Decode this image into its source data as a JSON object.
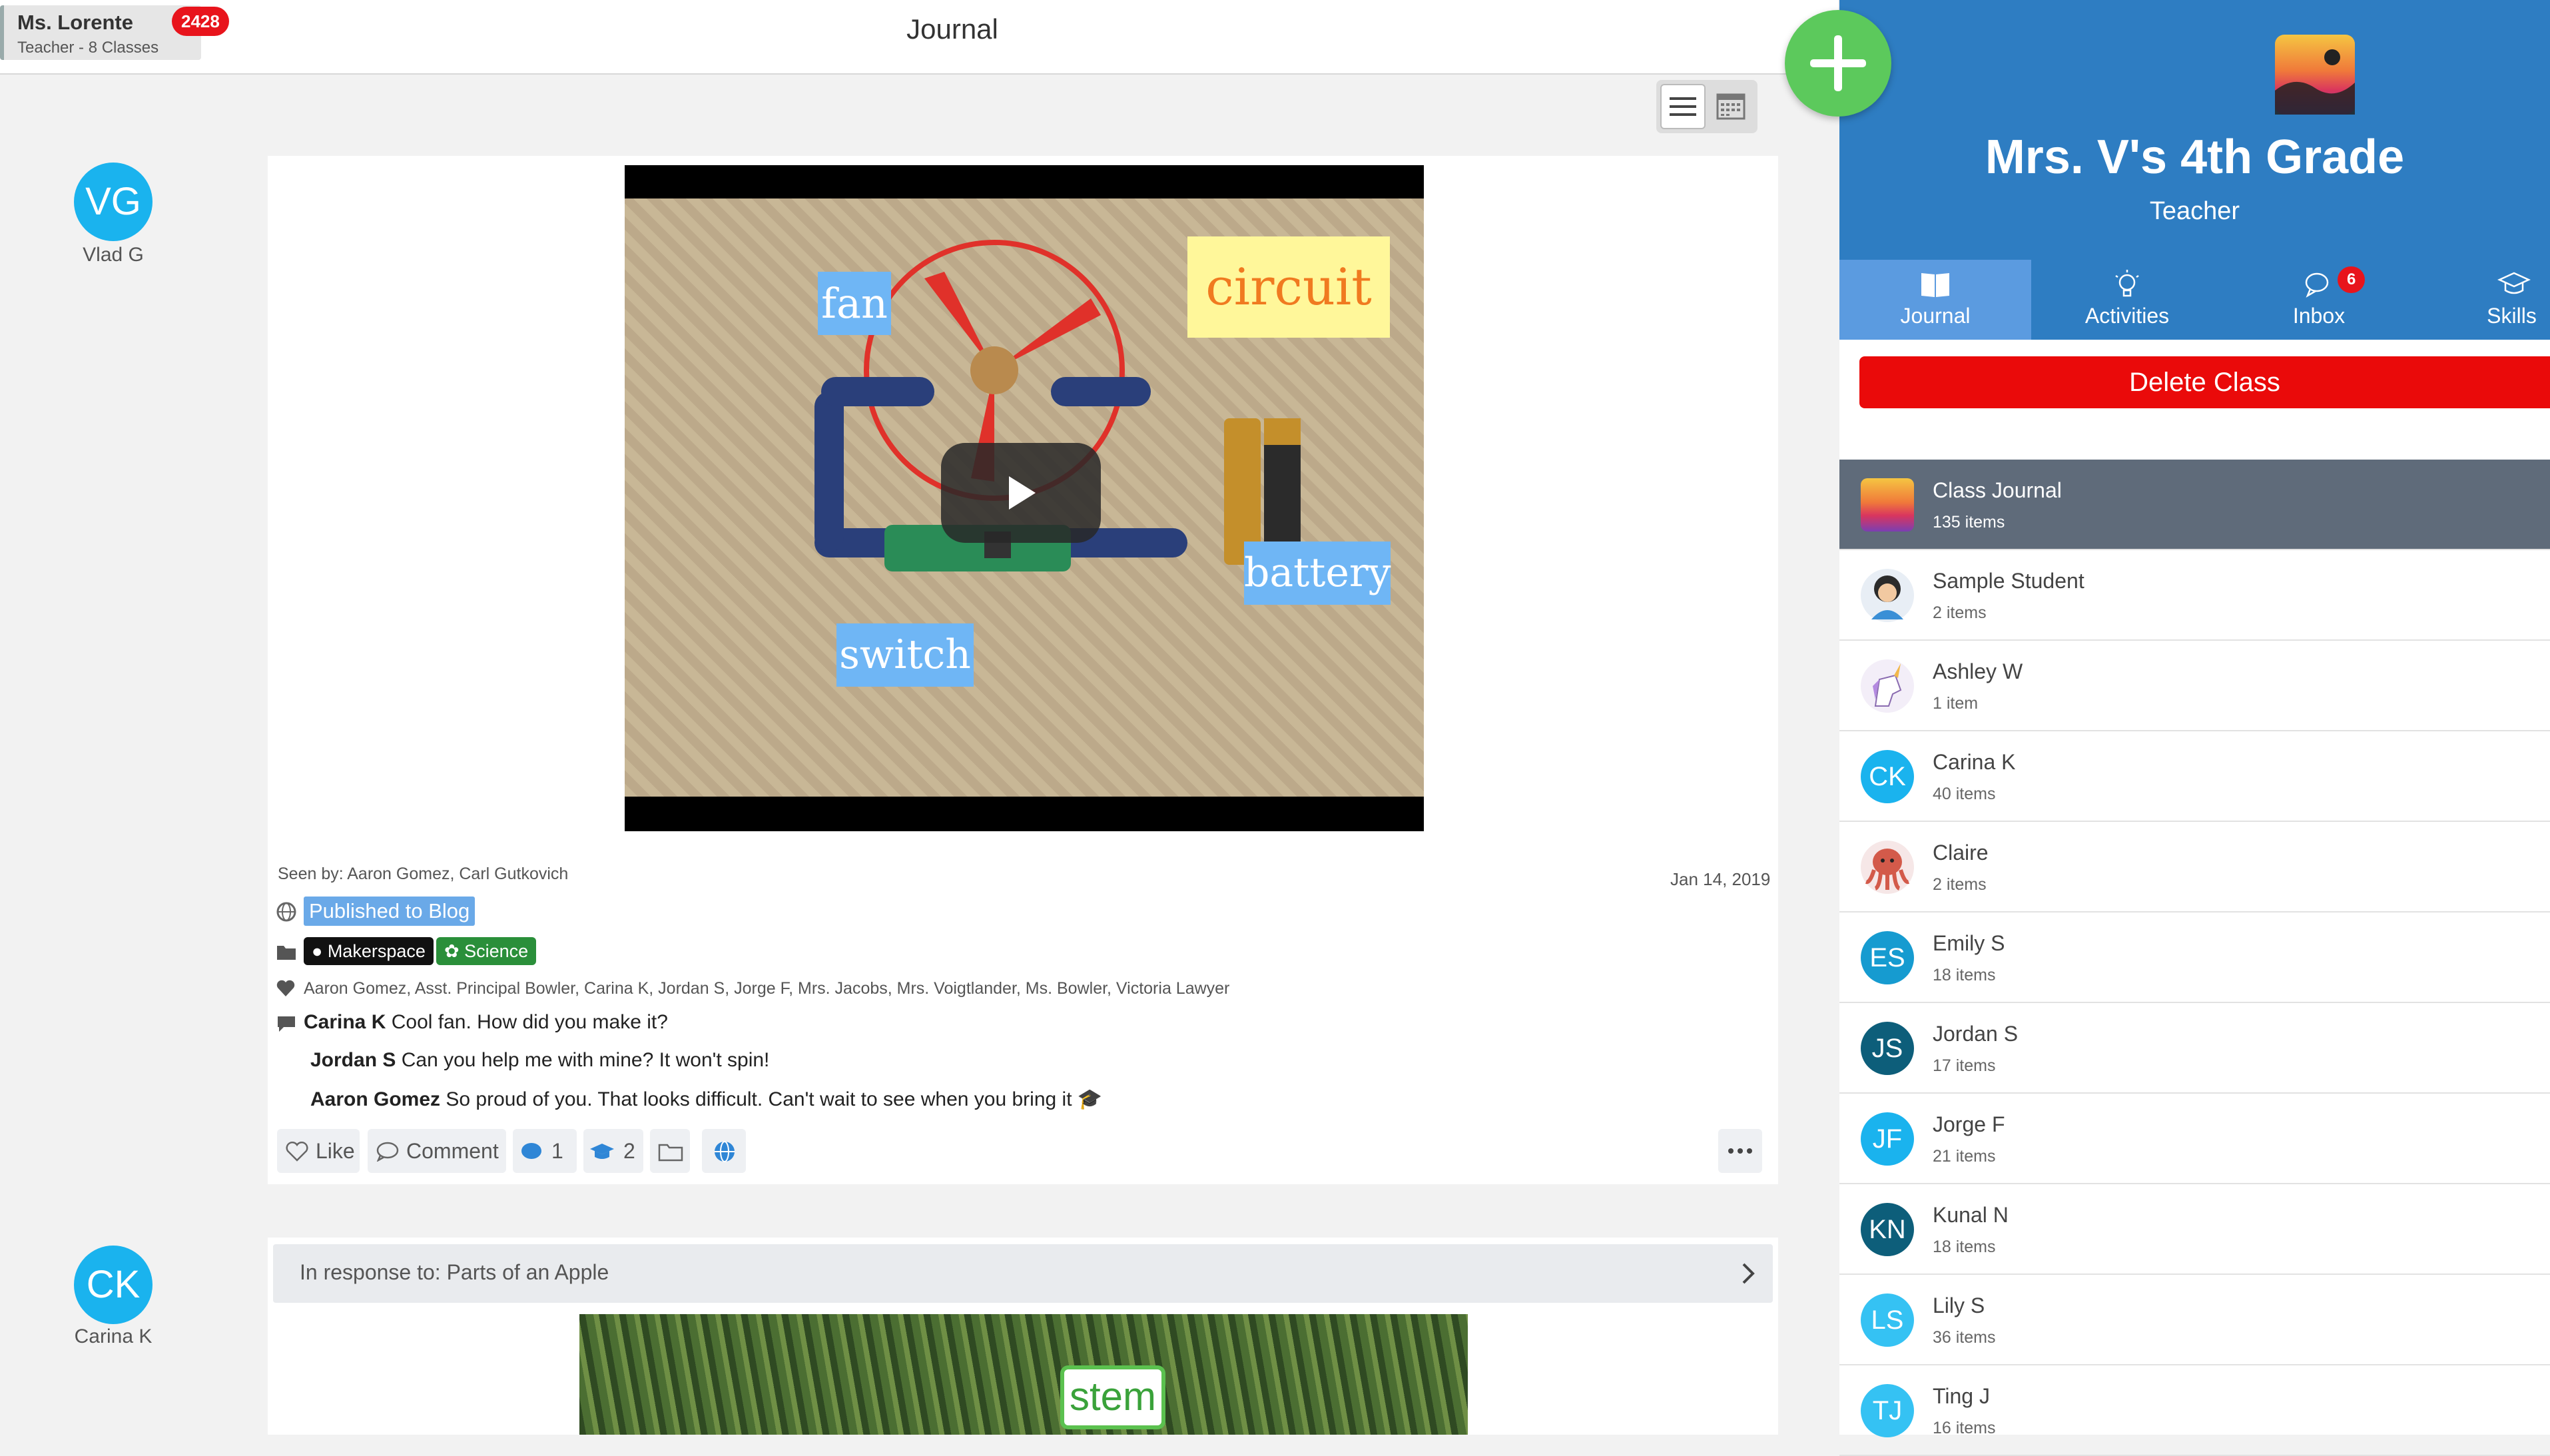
{
  "header": {
    "user_name": "Ms. Lorente",
    "user_sub": "Teacher - 8 Classes",
    "notif_count": "2428",
    "title": "Journal"
  },
  "feed": {
    "post1": {
      "author_initials": "VG",
      "author_name": "Vlad G",
      "video_labels": {
        "fan": "fan",
        "circuit": "circuit",
        "battery": "battery",
        "switch": "switch"
      },
      "seen_by": "Seen by: Aaron Gomez, Carl Gutkovich",
      "date": "Jan 14, 2019",
      "blog_tag": "Published to Blog",
      "folders": [
        "Makerspace",
        "Science"
      ],
      "likers": "Aaron Gomez, Asst. Principal Bowler, Carina K, Jordan S, Jorge F, Mrs. Jacobs, Mrs. Voigtlander, Ms. Bowler, Victoria Lawyer",
      "comments": [
        {
          "author": "Carina K",
          "text": "Cool fan. How did you make it?"
        },
        {
          "author": "Jordan S",
          "text": "Can you help me with mine? It won't spin!"
        },
        {
          "author": "Aaron Gomez",
          "text": "So proud of you. That looks difficult. Can't wait to see when you bring it"
        }
      ],
      "actions": {
        "like": "Like",
        "comment": "Comment",
        "comment_count": "1",
        "skill_count": "2"
      }
    },
    "post2": {
      "author_initials": "CK",
      "author_name": "Carina K",
      "response_to": "In response to: Parts of an Apple",
      "image_label": "stem"
    }
  },
  "panel": {
    "class_title": "Mrs. V's 4th Grade",
    "role": "Teacher",
    "tabs": [
      {
        "label": "Journal",
        "icon": "book-icon"
      },
      {
        "label": "Activities",
        "icon": "lightbulb-icon"
      },
      {
        "label": "Inbox",
        "icon": "chat-icon"
      },
      {
        "label": "Skills",
        "icon": "graduation-cap-icon"
      }
    ],
    "inbox_badge": "6",
    "delete_label": "Delete Class",
    "students": [
      {
        "name": "Class Journal",
        "count": "135 items",
        "initials": "",
        "avatar": "class-icon",
        "color": ""
      },
      {
        "name": "Sample Student",
        "count": "2 items",
        "initials": "",
        "avatar": "student-avatar",
        "color": "#e8eef5"
      },
      {
        "name": "Ashley W",
        "count": "1 item",
        "initials": "",
        "avatar": "unicorn-avatar",
        "color": "#f3eef8"
      },
      {
        "name": "Carina K",
        "count": "40 items",
        "initials": "CK",
        "avatar": "initials",
        "color": "#1ab3ee"
      },
      {
        "name": "Claire",
        "count": "2 items",
        "initials": "",
        "avatar": "octopus-avatar",
        "color": "#f6e7e7"
      },
      {
        "name": "Emily S",
        "count": "18 items",
        "initials": "ES",
        "avatar": "initials",
        "color": "#169bd0"
      },
      {
        "name": "Jordan S",
        "count": "17 items",
        "initials": "JS",
        "avatar": "initials",
        "color": "#0d5e7a"
      },
      {
        "name": "Jorge F",
        "count": "21 items",
        "initials": "JF",
        "avatar": "initials",
        "color": "#1ab3ee"
      },
      {
        "name": "Kunal N",
        "count": "18 items",
        "initials": "KN",
        "avatar": "initials",
        "color": "#0d5e7a"
      },
      {
        "name": "Lily S",
        "count": "36 items",
        "initials": "LS",
        "avatar": "initials",
        "color": "#35c2f3"
      },
      {
        "name": "Ting J",
        "count": "16 items",
        "initials": "TJ",
        "avatar": "initials",
        "color": "#35c2f3"
      }
    ]
  }
}
